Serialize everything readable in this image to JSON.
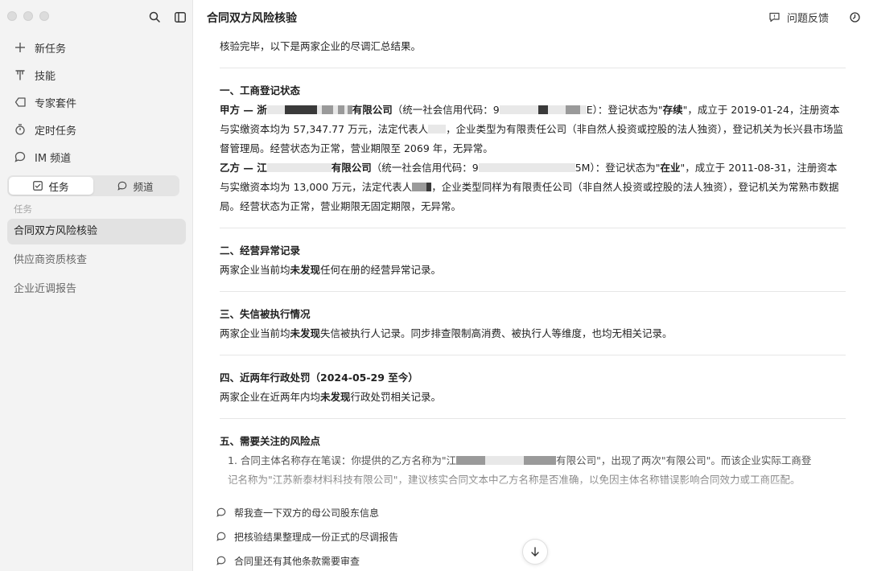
{
  "sidebar": {
    "nav": [
      {
        "label": "新任务",
        "icon": "plus-icon"
      },
      {
        "label": "技能",
        "icon": "skill-icon"
      },
      {
        "label": "专家套件",
        "icon": "tag-icon"
      },
      {
        "label": "定时任务",
        "icon": "timer-icon"
      },
      {
        "label": "IM 频道",
        "icon": "chat-icon"
      }
    ],
    "segment": {
      "tasks": "任务",
      "channels": "频道"
    },
    "section_label": "任务",
    "tasks": [
      "合同双方风险核验",
      "供应商资质核查",
      "企业近调报告"
    ]
  },
  "header": {
    "title": "合同双方风险核验",
    "feedback": "问题反馈"
  },
  "content": {
    "intro": "核验完毕，以下是两家企业的尽调汇总结果。",
    "s1": {
      "title": "一、工商登记状态",
      "a_label": "甲方 — 浙",
      "a_name_tail": "有限公司",
      "a_code_pre": "（统一社会信用代码：9",
      "a_code_tail": "E）：登记状态为\"",
      "a_status": "存续",
      "a_after_status": "\"，成立于 2019-01-24，注册资本与实缴资本均为 57,347.77 万元，法定代表人",
      "a_after_rep": "，企业类型为有限责任公司（非自然人投资或控股的法人独资），登记机关为长兴县市场监督管理局。经营状态为正常，营业期限至 2069 年，无异常。",
      "b_label": "乙方 — 江",
      "b_name_tail": "有限公司",
      "b_code_pre": "（统一社会信用代码：9",
      "b_code_tail": "5M）：登记状态为\"",
      "b_status": "在业",
      "b_after_status": "\"，成立于 2011-08-31，注册资本与实缴资本均为 13,000 万元，法定代表人",
      "b_after_rep": "，企业类型同样为有限责任公司（非自然人投资或控股的法人独资），登记机关为常熟市数据局。经营状态为正常，营业期限无固定期限，无异常。"
    },
    "s2": {
      "title": "二、经营异常记录",
      "pre": "两家企业当前均",
      "bold": "未发现",
      "post": "任何在册的经营异常记录。"
    },
    "s3": {
      "title": "三、失信被执行情况",
      "pre": "两家企业当前均",
      "bold": "未发现",
      "post": "失信被执行人记录。同步排查限制高消费、被执行人等维度，也均无相关记录。"
    },
    "s4": {
      "title": "四、近两年行政处罚（2024-05-29 至今）",
      "pre": "两家企业在近两年内均",
      "bold": "未发现",
      "post": "行政处罚相关记录。"
    },
    "s5": {
      "title": "五、需要关注的风险点",
      "item1_pre": "1. 合同主体名称存在笔误：你提供的乙方名称为\"江",
      "item1_mid": "有限公司\"，出现了两次\"有限公司\"。而该企业实际工商登",
      "item1_line2": "记名称为\"江苏新泰材料科技有限公司\"，建议核实合同文本中乙方名称是否准确，以免因主体名称错误影响合同效力或工商匹配。"
    }
  },
  "suggestions": [
    "帮我查一下双方的母公司股东信息",
    "把核验结果整理成一份正式的尽调报告",
    "合同里还有其他条款需要审查"
  ]
}
